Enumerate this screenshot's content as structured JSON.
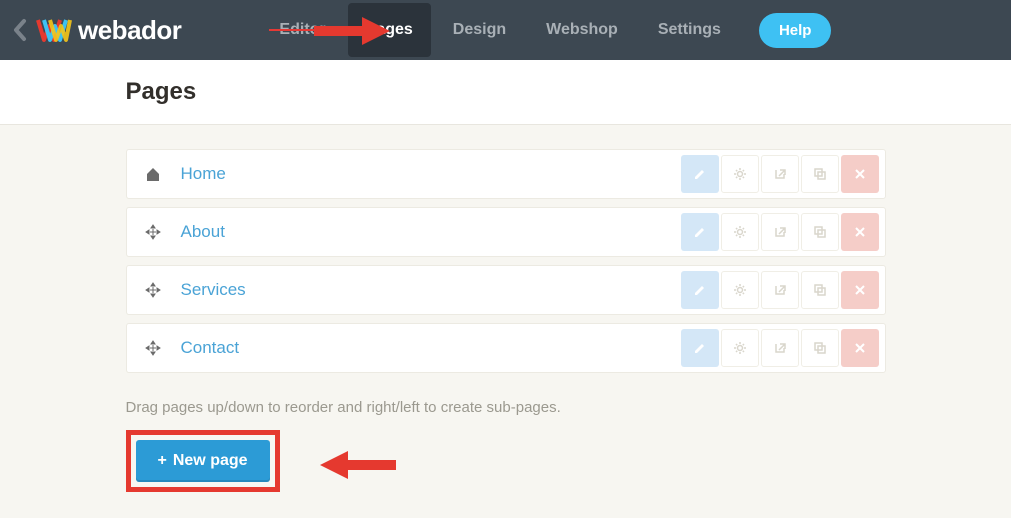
{
  "brand": {
    "name": "webador"
  },
  "nav": {
    "editor": "Editor",
    "pages": "Pages",
    "design": "Design",
    "webshop": "Webshop",
    "settings": "Settings",
    "help": "Help"
  },
  "header": {
    "title": "Pages"
  },
  "pages": [
    {
      "label": "Home"
    },
    {
      "label": "About"
    },
    {
      "label": "Services"
    },
    {
      "label": "Contact"
    }
  ],
  "hint": "Drag pages up/down to reorder and right/left to create sub-pages.",
  "new_page": {
    "label": "New page",
    "plus": "+"
  },
  "colors": {
    "accent": "#2c9bd6",
    "highlight": "#e5392f"
  }
}
